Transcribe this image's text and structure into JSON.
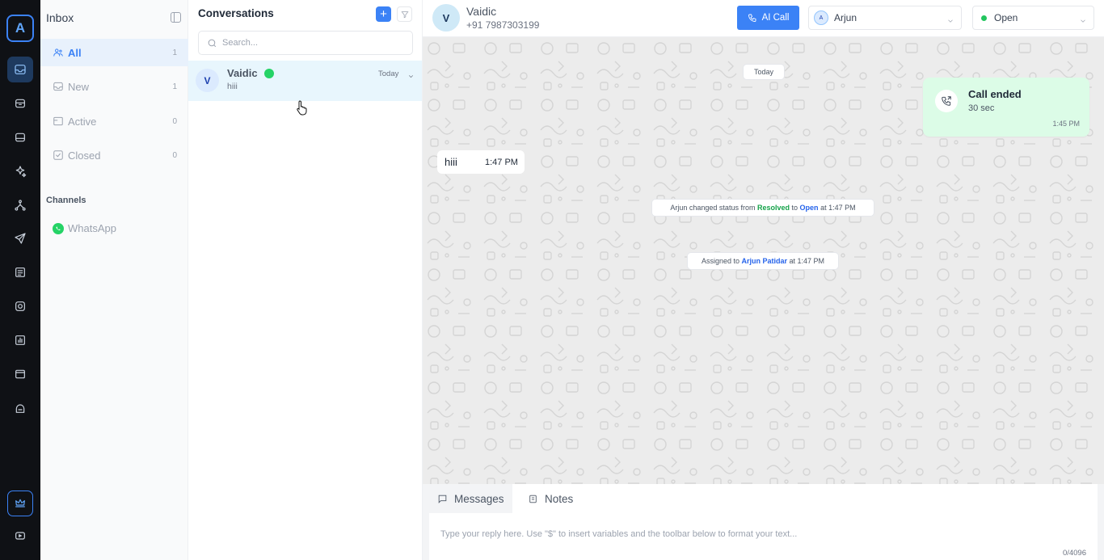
{
  "rail": {
    "logo": "A",
    "icons": [
      "inbox-icon",
      "archive-icon",
      "hard-drive-icon",
      "sparkles-icon",
      "network-icon",
      "send-icon",
      "list-icon",
      "instagram-icon",
      "chart-icon",
      "browser-icon",
      "bot-icon",
      "crown-icon",
      "video-icon"
    ]
  },
  "inbox": {
    "title": "Inbox",
    "items": [
      {
        "label": "All",
        "count": "1",
        "icon": "users-icon"
      },
      {
        "label": "New",
        "count": "1",
        "icon": "inbox-tray-icon"
      },
      {
        "label": "Active",
        "count": "0",
        "icon": "folder-icon"
      },
      {
        "label": "Closed",
        "count": "0",
        "icon": "check-square-icon"
      }
    ],
    "channels_heading": "Channels",
    "channels": [
      {
        "label": "WhatsApp",
        "icon": "whatsapp-icon"
      }
    ]
  },
  "conversations": {
    "title": "Conversations",
    "search_placeholder": "Search...",
    "items": [
      {
        "avatar": "V",
        "name": "Vaidic",
        "preview": "hiii",
        "time": "Today"
      }
    ]
  },
  "chat": {
    "contact": {
      "avatar": "V",
      "name": "Vaidic",
      "phone": "+91 7987303199"
    },
    "ai_call_label": "AI Call",
    "assignee": {
      "avatar": "A",
      "name": "Arjun"
    },
    "status": {
      "label": "Open",
      "color": "#22c55e"
    },
    "date_divider": "Today",
    "call": {
      "title": "Call ended",
      "duration": "30 sec",
      "time": "1:45 PM"
    },
    "message": {
      "text": "hiii",
      "time": "1:47 PM"
    },
    "event_status": {
      "prefix": "Arjun changed status from ",
      "from": "Resolved",
      "mid": " to ",
      "to": "Open",
      "suffix": " at 1:47 PM"
    },
    "event_assign": {
      "prefix": "Assigned to ",
      "name": "Arjun Patidar",
      "suffix": " at 1:47 PM"
    }
  },
  "composer": {
    "tabs": [
      {
        "label": "Messages",
        "icon": "message-icon"
      },
      {
        "label": "Notes",
        "icon": "notes-icon"
      }
    ],
    "placeholder": "Type your reply here. Use \"$\" to insert variables and the toolbar below to format your text...",
    "counter": "0/4096"
  },
  "colors": {
    "accent": "#3b82f6",
    "whatsapp": "#25d366",
    "call_bg": "#dcfce7",
    "rail_bg": "#0f1115"
  }
}
